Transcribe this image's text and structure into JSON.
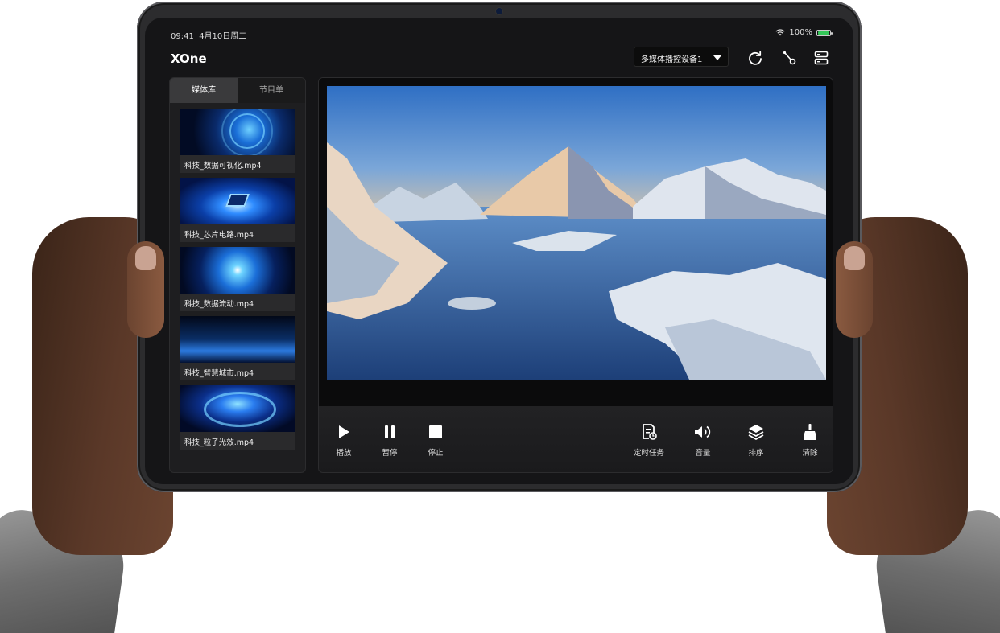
{
  "status_bar": {
    "time": "09:41",
    "date": "4月10日周二",
    "battery": "100%"
  },
  "app": {
    "title": "XOne"
  },
  "device_select": {
    "value": "多媒体播控设备1"
  },
  "left_panel": {
    "tabs": [
      {
        "label": "媒体库",
        "active": true
      },
      {
        "label": "节目单",
        "active": false
      }
    ],
    "media_items": [
      {
        "label": "科技_数据可视化.mp4"
      },
      {
        "label": "科技_芯片电路.mp4"
      },
      {
        "label": "科技_数据流动.mp4"
      },
      {
        "label": "科技_智慧城市.mp4"
      },
      {
        "label": "科技_粒子光效.mp4"
      }
    ]
  },
  "controls": {
    "play": "播放",
    "pause": "暂停",
    "stop": "停止",
    "schedule": "定时任务",
    "volume": "音量",
    "sort": "排序",
    "clear": "清除"
  },
  "colors": {
    "accent_active_tab": "#3a3a3c",
    "battery_green": "#35c759",
    "panel_bg": "#1e1e20"
  }
}
